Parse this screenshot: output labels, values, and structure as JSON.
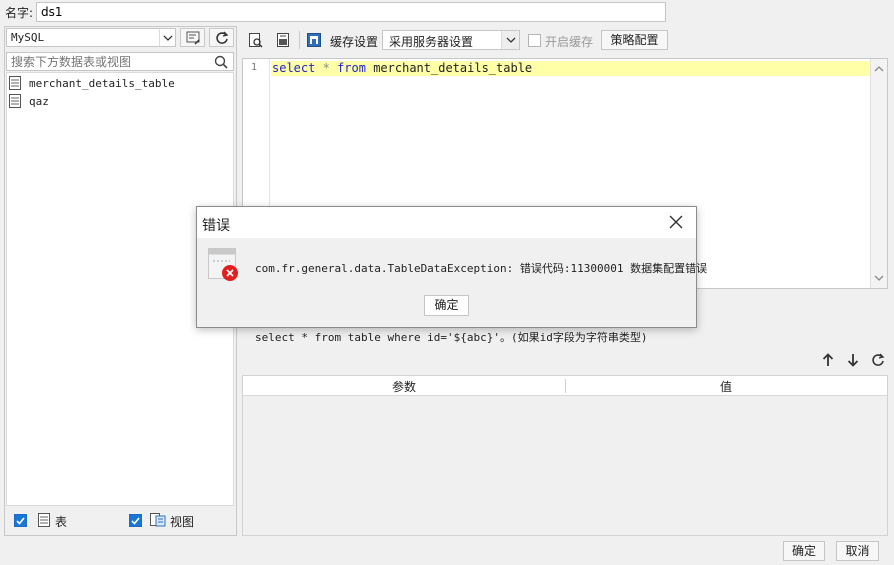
{
  "name_field": {
    "label": "名字:",
    "value": "ds1"
  },
  "left_panel": {
    "db_select": "MySQL",
    "search_placeholder": "搜索下方数据表或视图",
    "tables": [
      "merchant_details_table",
      "qaz"
    ],
    "footer": {
      "table_label": "表",
      "view_label": "视图"
    }
  },
  "toolbar": {
    "cache_label": "缓存设置",
    "cache_option": "采用服务器设置",
    "enable_cache_label": "开启缓存",
    "strategy_button": "策略配置"
  },
  "editor": {
    "line_number": "1",
    "tokens": {
      "kw_select": "select",
      "star": "*",
      "kw_from": "from",
      "table": "merchant_details_table"
    }
  },
  "hint": "select * from table where id='${abc}'。(如果id字段为字符串类型)",
  "params_table": {
    "col_param": "参数",
    "col_value": "值"
  },
  "footer": {
    "ok": "确定",
    "cancel": "取消"
  },
  "dialog": {
    "title": "错误",
    "message": "com.fr.general.data.TableDataException: 错误代码:11300001 数据集配置错误",
    "ok": "确定"
  },
  "colors": {
    "keyword": "#2222cc",
    "highlight_line": "#ffffa8",
    "check_blue": "#1976d2",
    "error_red": "#e02020"
  }
}
